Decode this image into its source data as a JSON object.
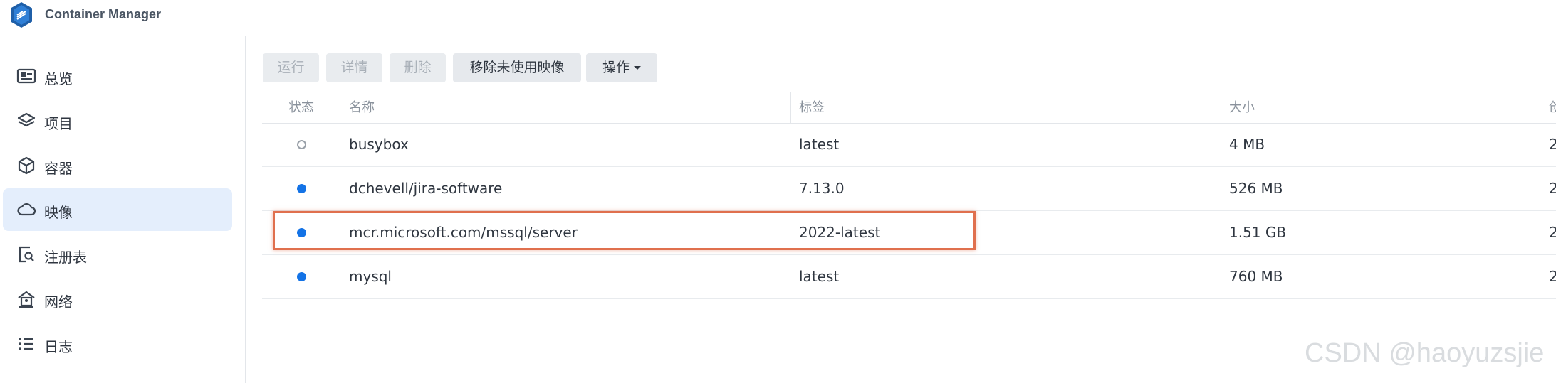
{
  "app": {
    "title": "Container Manager"
  },
  "sidebar": {
    "items": [
      {
        "label": "总览",
        "icon": "overview-card-icon"
      },
      {
        "label": "项目",
        "icon": "layers-icon"
      },
      {
        "label": "容器",
        "icon": "cube-icon"
      },
      {
        "label": "映像",
        "icon": "cloud-icon",
        "active": true
      },
      {
        "label": "注册表",
        "icon": "registry-search-icon"
      },
      {
        "label": "网络",
        "icon": "network-house-icon"
      },
      {
        "label": "日志",
        "icon": "list-icon"
      }
    ]
  },
  "toolbar": {
    "run_label": "运行",
    "details_label": "详情",
    "delete_label": "删除",
    "remove_unused_label": "移除未使用映像",
    "actions_label": "操作"
  },
  "table": {
    "columns": [
      "状态",
      "名称",
      "标签",
      "大小",
      "创"
    ],
    "rows": [
      {
        "status": "stopped",
        "name": "busybox",
        "tag": "latest",
        "size": "4 MB",
        "created": "2"
      },
      {
        "status": "running",
        "name": "dchevell/jira-software",
        "tag": "7.13.0",
        "size": "526 MB",
        "created": "2"
      },
      {
        "status": "running",
        "name": "mcr.microsoft.com/mssql/server",
        "tag": "2022-latest",
        "size": "1.51 GB",
        "created": "2"
      },
      {
        "status": "running",
        "name": "mysql",
        "tag": "latest",
        "size": "760 MB",
        "created": "2"
      }
    ]
  },
  "colors": {
    "accent": "#1473e6",
    "active_nav_bg": "#e4eefc",
    "highlight_border": "#e0704e"
  },
  "watermark": "CSDN @haoyuzsjie"
}
